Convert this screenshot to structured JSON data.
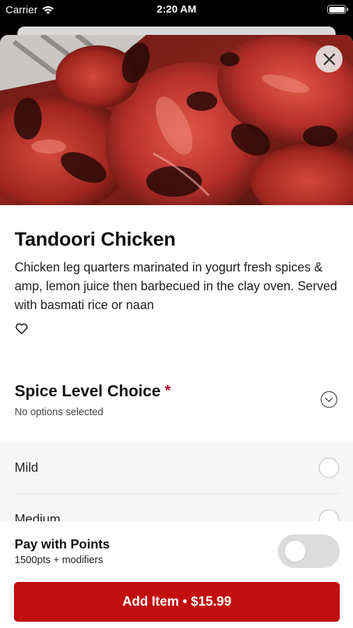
{
  "status_bar": {
    "carrier": "Carrier",
    "time": "2:20 AM",
    "icons": [
      "wifi-icon",
      "battery-icon"
    ]
  },
  "item": {
    "image": "food-photo",
    "title": "Tandoori Chicken",
    "description": "Chicken leg quarters marinated in yogurt fresh spices & amp, lemon juice then barbecued in the clay oven. Served with basmati rice or naan"
  },
  "modifier_group": {
    "title": "Spice Level Choice",
    "required_mark": "*",
    "subtitle": "No options selected",
    "options": [
      {
        "label": "Mild",
        "selected": false
      },
      {
        "label": "Medium",
        "selected": false
      }
    ]
  },
  "points": {
    "title": "Pay with Points",
    "subtitle": "1500pts + modifiers",
    "enabled": false
  },
  "add_button": {
    "label": "Add Item • $15.99"
  },
  "colors": {
    "accent": "#c10e0e",
    "required": "#b5123a",
    "options_bg": "#f6f6f6"
  }
}
